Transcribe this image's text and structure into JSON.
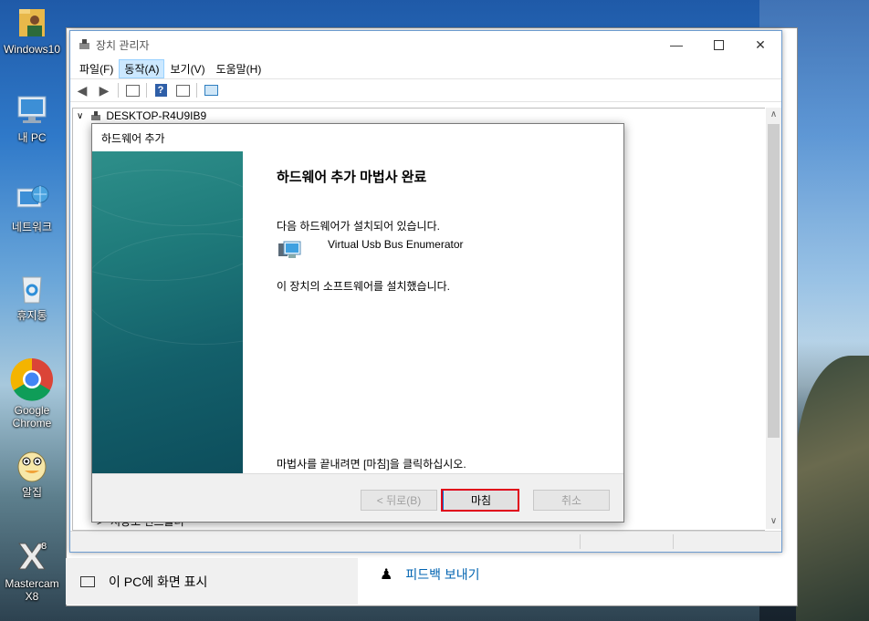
{
  "desktop": {
    "icons": [
      {
        "label": "Windows10",
        "icon": "folder-user-icon"
      },
      {
        "label": "내 PC",
        "icon": "computer-icon"
      },
      {
        "label": "네트워크",
        "icon": "network-icon"
      },
      {
        "label": "휴지통",
        "icon": "recycle-bin-icon"
      },
      {
        "label": "Google Chrome",
        "icon": "chrome-icon"
      },
      {
        "label": "알집",
        "icon": "alzip-icon"
      },
      {
        "label": "Mastercam X8",
        "icon": "mastercam-icon"
      }
    ]
  },
  "background_window": {
    "show_pc_label": "이 PC에 화면 표시",
    "feedback_label": "피드백 보내기"
  },
  "device_manager": {
    "title": "장치 관리자",
    "menu": [
      "파일(F)",
      "동작(A)",
      "보기(V)",
      "도움말(H)"
    ],
    "active_menu_index": 1,
    "tree_root": "DESKTOP-R4U9IB9",
    "partial_row": "저장소 컨트롤러"
  },
  "wizard": {
    "title": "하드웨어 추가",
    "heading": "하드웨어 추가 마법사 완료",
    "installed_intro": "다음 하드웨어가 설치되어 있습니다.",
    "device_name": "Virtual Usb Bus Enumerator",
    "installed_msg": "이 장치의 소프트웨어를 설치했습니다.",
    "finish_hint": "마법사를 끝내려면 [마침]을 클릭하십시오.",
    "buttons": {
      "back": "< 뒤로(B)",
      "finish": "마침",
      "cancel": "취소"
    }
  },
  "colors": {
    "highlight": "#e0001a",
    "menu_active": "#cce8ff",
    "wizard_side": "#1f7b7b"
  }
}
